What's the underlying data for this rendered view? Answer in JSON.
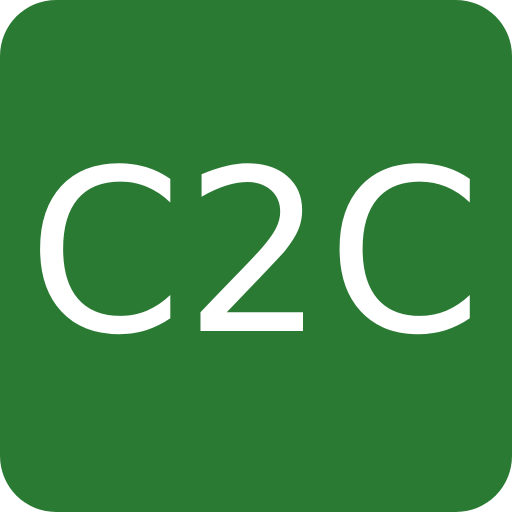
{
  "icon": {
    "label": "C2C",
    "background_color": "#2b7a34",
    "text_color": "#ffffff"
  }
}
